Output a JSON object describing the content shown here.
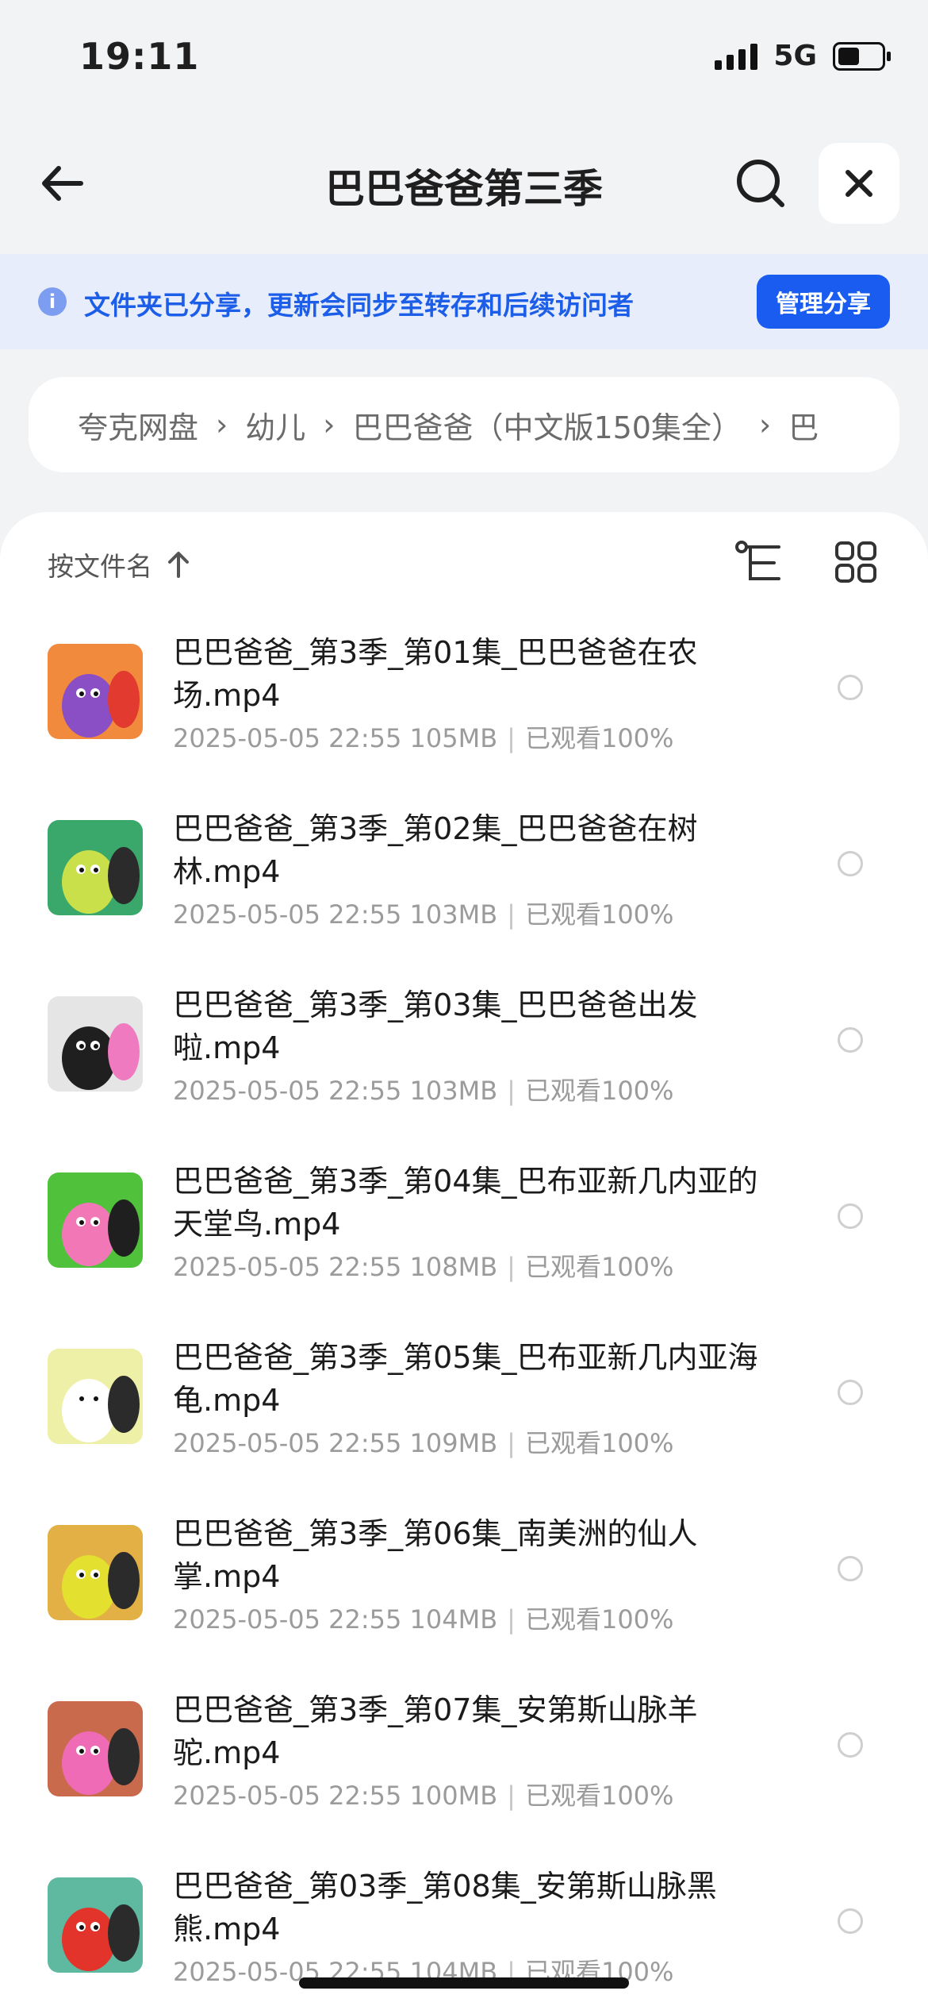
{
  "status_bar": {
    "time": "19:11",
    "network": "5G",
    "battery_level": 0.6
  },
  "nav": {
    "title": "巴巴爸爸第三季",
    "back_icon": "arrow-left-icon",
    "search_icon": "search-icon",
    "close_icon": "close-icon"
  },
  "banner": {
    "text": "文件夹已分享，更新会同步至转存和后续访问者",
    "button": "管理分享",
    "icon_label": "i"
  },
  "breadcrumb": [
    "夸克网盘",
    "幼儿",
    "巴巴爸爸（中文版150集全）",
    "巴"
  ],
  "breadcrumb_sep": "›",
  "sort": {
    "label": "按文件名",
    "icon": "sort-asc-icon"
  },
  "files": [
    {
      "name": "巴巴爸爸_第3季_第01集_巴巴爸爸在农场.mp4",
      "date": "2025-05-05 22:55",
      "size": "105MB",
      "watched": "已观看100%",
      "thumb_colors": [
        "#f18a3c",
        "#8a4fc5",
        "#e23a2f"
      ]
    },
    {
      "name": "巴巴爸爸_第3季_第02集_巴巴爸爸在树林.mp4",
      "date": "2025-05-05 22:55",
      "size": "103MB",
      "watched": "已观看100%",
      "thumb_colors": [
        "#3aa86b",
        "#c9e04a",
        "#2b2b2b"
      ]
    },
    {
      "name": "巴巴爸爸_第3季_第03集_巴巴爸爸出发啦.mp4",
      "date": "2025-05-05 22:55",
      "size": "103MB",
      "watched": "已观看100%",
      "thumb_colors": [
        "#e5e5e5",
        "#1f1f1f",
        "#f07ac0"
      ]
    },
    {
      "name": "巴巴爸爸_第3季_第04集_巴布亚新几内亚的天堂鸟.mp4",
      "date": "2025-05-05 22:55",
      "size": "108MB",
      "watched": "已观看100%",
      "thumb_colors": [
        "#4fc13a",
        "#f277b7",
        "#1f1f1f"
      ]
    },
    {
      "name": "巴巴爸爸_第3季_第05集_巴布亚新几内亚海龟.mp4",
      "date": "2025-05-05 22:55",
      "size": "109MB",
      "watched": "已观看100%",
      "thumb_colors": [
        "#eef0a8",
        "#ffffff",
        "#2b2b2b"
      ]
    },
    {
      "name": "巴巴爸爸_第3季_第06集_南美洲的仙人掌.mp4",
      "date": "2025-05-05 22:55",
      "size": "104MB",
      "watched": "已观看100%",
      "thumb_colors": [
        "#e2b044",
        "#e4e030",
        "#2b2b2b"
      ]
    },
    {
      "name": "巴巴爸爸_第3季_第07集_安第斯山脉羊驼.mp4",
      "date": "2025-05-05 22:55",
      "size": "100MB",
      "watched": "已观看100%",
      "thumb_colors": [
        "#c96a4c",
        "#f06bb6",
        "#2b2b2b"
      ]
    },
    {
      "name": "巴巴爸爸_第03季_第08集_安第斯山脉黑熊.mp4",
      "date": "2025-05-05 22:55",
      "size": "104MB",
      "watched": "已观看100%",
      "thumb_colors": [
        "#5fb8a0",
        "#e2342b",
        "#2b2b2b"
      ]
    }
  ],
  "colors": {
    "accent": "#1a5cf0",
    "banner_bg": "#e8edfb",
    "banner_text": "#1d5ee8"
  }
}
